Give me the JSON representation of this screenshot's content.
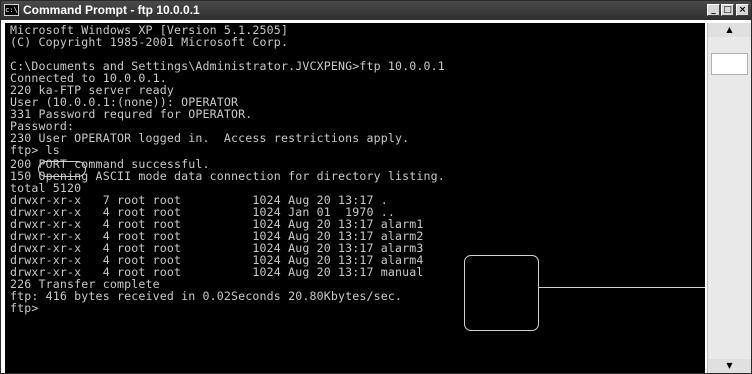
{
  "window": {
    "icon_text": "c:\\",
    "title": "Command Prompt - ftp 10.0.0.1",
    "controls": {
      "minimize": "_",
      "maximize": "□",
      "close": "×"
    }
  },
  "console_lines": [
    "Microsoft Windows XP [Version 5.1.2505]",
    "(C) Copyright 1985-2001 Microsoft Corp.",
    "",
    "C:\\Documents and Settings\\Administrator.JVCXPENG>ftp 10.0.0.1",
    "Connected to 10.0.0.1.",
    "220 ka-FTP server ready",
    "User (10.0.0.1:(none)): OPERATOR",
    "331 Password requred for OPERATOR.",
    "Password:",
    "230 User OPERATOR logged in.  Access restrictions apply.",
    "ftp> ls",
    "200 PORT command successful.",
    "150 Opening ASCII mode data connection for directory listing.",
    "total 5120",
    "drwxr-xr-x   7 root root          1024 Aug 20 13:17 .",
    "drwxr-xr-x   4 root root          1024 Jan 01  1970 ..",
    "drwxr-xr-x   4 root root          1024 Aug 20 13:17 alarm1",
    "drwxr-xr-x   4 root root          1024 Aug 20 13:17 alarm2",
    "drwxr-xr-x   4 root root          1024 Aug 20 13:17 alarm3",
    "drwxr-xr-x   4 root root          1024 Aug 20 13:17 alarm4",
    "drwxr-xr-x   4 root root          1024 Aug 20 13:17 manual",
    "226 Transfer complete",
    "ftp: 416 bytes received in 0.02Seconds 20.80Kbytes/sec.",
    "ftp>"
  ],
  "scrollbar": {
    "up_arrow": "▲",
    "down_arrow": "▼"
  },
  "colors": {
    "console_bg": "#000000",
    "console_text": "#c8c8c8",
    "title_bg": "#3a3a3a",
    "annotation": "#d0d0d0"
  }
}
